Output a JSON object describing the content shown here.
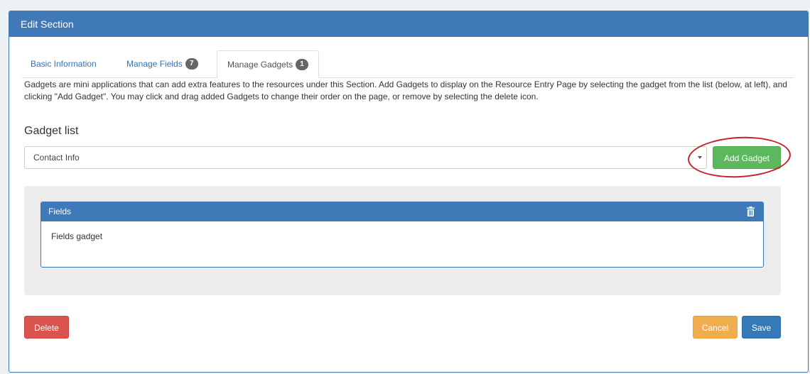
{
  "panel": {
    "title": "Edit Section"
  },
  "tabs": [
    {
      "label": "Basic Information",
      "badge": null
    },
    {
      "label": "Manage Fields",
      "badge": "7"
    },
    {
      "label": "Manage Gadgets",
      "badge": "1"
    }
  ],
  "description": "Gadgets are mini applications that can add extra features to the resources under this Section. Add Gadgets to display on the Resource Entry Page by selecting the gadget from the list (below, at left), and clicking \"Add Gadget\". You may click and drag added Gadgets to change their order on the page, or remove by selecting the delete icon.",
  "gadget_list": {
    "label": "Gadget list",
    "selected": "Contact Info",
    "add_button": "Add Gadget"
  },
  "gadgets": [
    {
      "title": "Fields",
      "body": "Fields gadget",
      "icon": "trash-icon"
    }
  ],
  "actions": {
    "delete": "Delete",
    "cancel": "Cancel",
    "save": "Save"
  },
  "colors": {
    "primary": "#4079b8",
    "success": "#5cb85c",
    "danger": "#d9534f",
    "warning": "#f0ad4e",
    "highlight": "#c7202a"
  }
}
